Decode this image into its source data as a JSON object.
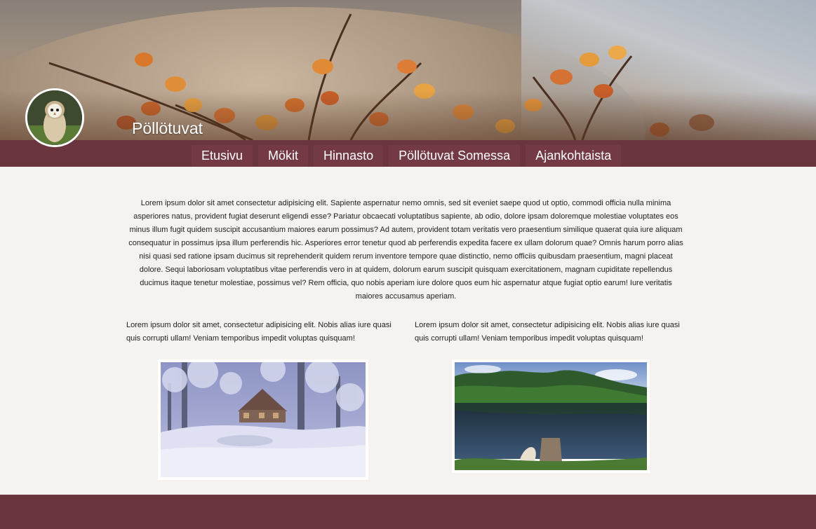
{
  "header": {
    "brand": "Pöllötuvat",
    "logo_icon": "owl-avatar-icon",
    "banner": "autumn-leaves-banner"
  },
  "nav": {
    "items": [
      "Etusivu",
      "Mökit",
      "Hinnasto",
      "Pöllötuvat Somessa",
      "Ajankohtaista"
    ]
  },
  "main": {
    "intro": "Lorem ipsum dolor sit amet consectetur adipisicing elit. Sapiente aspernatur nemo omnis, sed sit eveniet saepe quod ut optio, commodi officia nulla minima asperiores natus, provident fugiat deserunt eligendi esse? Pariatur obcaecati voluptatibus sapiente, ab odio, dolore ipsam doloremque molestiae voluptates eos minus illum fugit quidem suscipit accusantium maiores earum possimus? Ad autem, provident totam veritatis vero praesentium similique quaerat quia iure aliquam consequatur in possimus ipsa illum perferendis hic. Asperiores error tenetur quod ab perferendis expedita facere ex ullam dolorum quae? Omnis harum porro alias nisi quasi sed ratione ipsam ducimus sit reprehenderit quidem rerum inventore tempore quae distinctio, nemo officiis quibusdam praesentium, magni placeat dolore. Sequi laboriosam voluptatibus vitae perferendis vero in at quidem, dolorum earum suscipit quisquam exercitationem, magnam cupiditate repellendus ducimus itaque tenetur molestiae, possimus vel? Rem officia, quo nobis aperiam iure dolore quos eum hic aspernatur atque fugiat optio earum! Iure veritatis maiores accusamus aperiam.",
    "col_left": "Lorem ipsum dolor sit amet, consectetur adipisicing elit. Nobis alias iure quasi quis corrupti ullam! Veniam temporibus impedit voluptas quisquam!",
    "col_right": "Lorem ipsum dolor sit amet, consectetur adipisicing elit. Nobis alias iure quasi quis corrupti ullam! Veniam temporibus impedit voluptas quisquam!",
    "images": [
      "winter-cabin-photo",
      "lake-dock-photo"
    ]
  },
  "colors": {
    "nav_bg": "#6b3540",
    "page_bg": "#f5f2f0",
    "text": "#222222"
  }
}
